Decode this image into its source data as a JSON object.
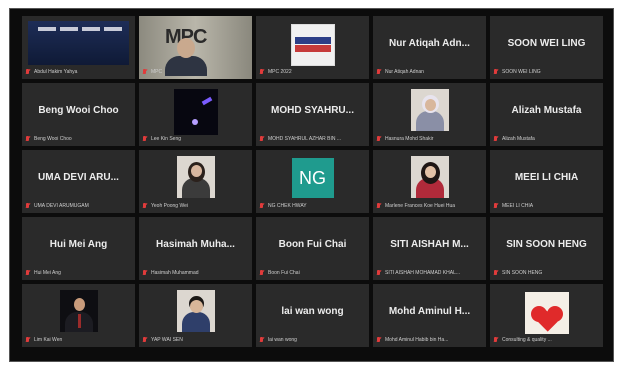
{
  "participants": [
    {
      "id": "p1",
      "label": "Abdul Hakim Yahya",
      "type": "screen"
    },
    {
      "id": "p2",
      "label": "MPC",
      "type": "video",
      "sign": "MPC"
    },
    {
      "id": "p3",
      "label": "MPC 2022",
      "type": "logo"
    },
    {
      "id": "p4",
      "label": "Nur Atiqah Adnan",
      "display": "Nur Atiqah Adn...",
      "type": "name"
    },
    {
      "id": "p5",
      "label": "SOON WEI LING",
      "display": "SOON WEI LING",
      "type": "name"
    },
    {
      "id": "p6",
      "label": "Beng Wooi Choo",
      "display": "Beng Wooi Choo",
      "type": "name"
    },
    {
      "id": "p7",
      "label": "Lee Kin Seng",
      "type": "video-dark"
    },
    {
      "id": "p8",
      "label": "MOHD SYAHRUL AZHAR BIN ...",
      "display": "MOHD SYAHRU...",
      "type": "name"
    },
    {
      "id": "p9",
      "label": "Hasnura Mohd Shakir",
      "type": "photo",
      "photo": "hijab"
    },
    {
      "id": "p10",
      "label": "Alizah Mustafa",
      "display": "Alizah Mustafa",
      "type": "name"
    },
    {
      "id": "p11",
      "label": "UMA DEVI ARUMUGAM",
      "display": "UMA DEVI ARU...",
      "type": "name"
    },
    {
      "id": "p12",
      "label": "Yeoh Poong Wei",
      "type": "photo",
      "photo": "woman-light"
    },
    {
      "id": "p13",
      "label": "NG CHEK HWAY",
      "type": "initials",
      "initials": "NG"
    },
    {
      "id": "p14",
      "label": "Marlene Frances Koe Huei Hua",
      "type": "photo",
      "photo": "woman-dark-hair"
    },
    {
      "id": "p15",
      "label": "MEEI LI CHIA",
      "display": "MEEI LI CHIA",
      "type": "name"
    },
    {
      "id": "p16",
      "label": "Hui Mei Ang",
      "display": "Hui Mei Ang",
      "type": "name"
    },
    {
      "id": "p17",
      "label": "Hasimah Muhammad",
      "display": "Hasimah Muha...",
      "type": "name"
    },
    {
      "id": "p18",
      "label": "Boon Fui Chai",
      "display": "Boon Fui Chai",
      "type": "name"
    },
    {
      "id": "p19",
      "label": "SITI AISHAH MOHAMAD KHAL...",
      "display": "SITI AISHAH M...",
      "type": "name"
    },
    {
      "id": "p20",
      "label": "SIN SOON HENG",
      "display": "SIN SOON HENG",
      "type": "name"
    },
    {
      "id": "p21",
      "label": "Lim Kai Wen",
      "type": "photo",
      "photo": "man-dark"
    },
    {
      "id": "p22",
      "label": "YAP WAI SEN",
      "type": "photo",
      "photo": "man-light"
    },
    {
      "id": "p23",
      "label": "lai wan wong",
      "display": "lai wan wong",
      "type": "name"
    },
    {
      "id": "p24",
      "label": "Mohd Aminul Habib bin Ha...",
      "display": "Mohd Aminul H...",
      "type": "name"
    },
    {
      "id": "p25",
      "label": "Consulting & quality ...",
      "type": "hearts"
    }
  ],
  "colors": {
    "background": "#0c0c0c",
    "tile": "#2a2a2a",
    "active_border": "#d6d24a",
    "muted_icon": "#e03b3b",
    "avatar_ng": "#1f9b8e"
  }
}
